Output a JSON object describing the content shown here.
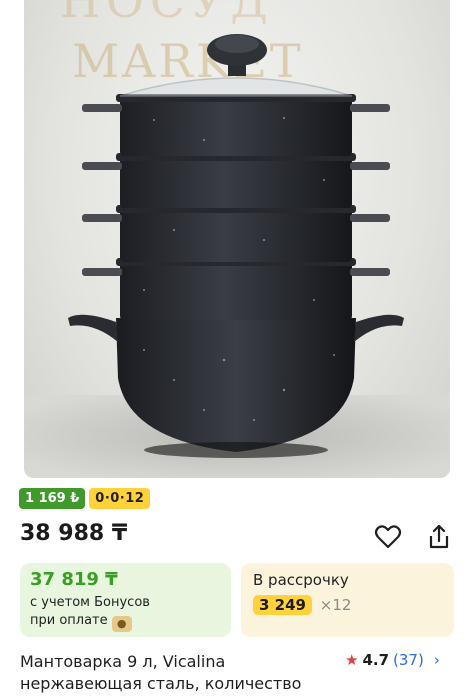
{
  "photo": {
    "watermark_line1": "НОСУД",
    "watermark_line2": "MARKET"
  },
  "badges": {
    "green": "1 169 ₺",
    "yellow": "0·0·12"
  },
  "price": {
    "main": "38 988 ₸"
  },
  "actions": {
    "favorite_icon": "heart-icon",
    "share_icon": "share-icon"
  },
  "bonus_card": {
    "price": "37 819 ₸",
    "note_line1": "с учетом Бонусов",
    "note_line2": "при оплате"
  },
  "credit_card": {
    "title": "В рассрочку",
    "amount": "3 249",
    "times": "×12"
  },
  "product": {
    "title_line1": "Мантоварка 9 л, Vicalina",
    "title_line2": "нержавеющая сталь, количество"
  },
  "rating": {
    "value": "4.7",
    "count": "(37)"
  },
  "colors": {
    "accent_green": "#3f9a2b",
    "accent_yellow": "#ffd23b",
    "rating_star": "#e0413b",
    "link_blue": "#2c6fd6"
  }
}
